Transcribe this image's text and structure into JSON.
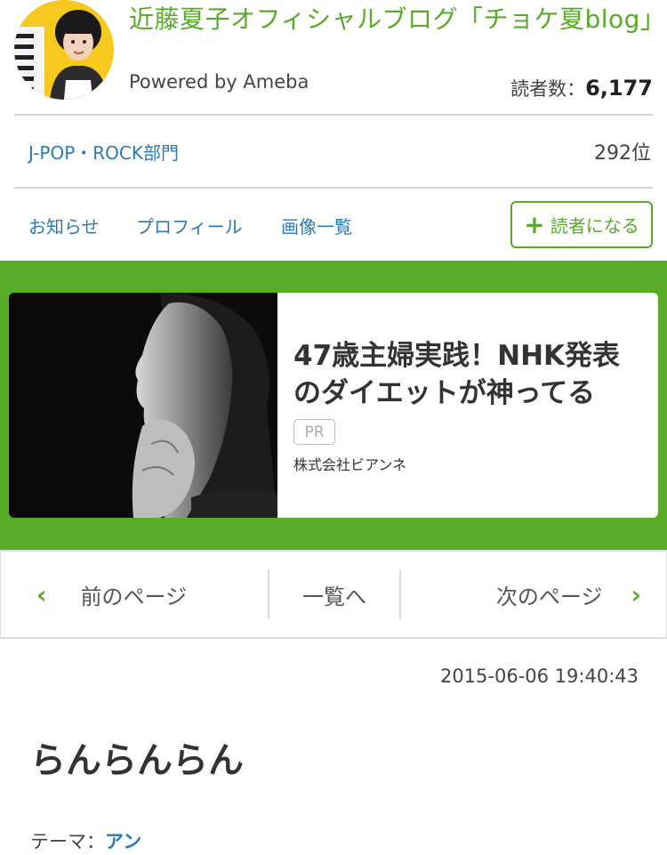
{
  "header": {
    "blog_title": "近藤夏子オフィシャルブログ「チョケ夏blog」",
    "powered_by": "Powered by Ameba",
    "readers_label": "読者数：",
    "readers_count": "6,177"
  },
  "ranking": {
    "genre": "J-POP・ROCK部門",
    "rank": "292位"
  },
  "nav": {
    "items": [
      {
        "label": "お知らせ"
      },
      {
        "label": "プロフィール"
      },
      {
        "label": "画像一覧"
      }
    ],
    "follow_label": "読者になる"
  },
  "ad": {
    "headline": "47歳主婦実践！NHK発表のダイエットが神ってる",
    "badge": "PR",
    "advertiser": "株式会社ビアンネ"
  },
  "pager": {
    "prev": "前のページ",
    "list": "一覧へ",
    "next": "次のページ"
  },
  "entry": {
    "date": "2015-06-06 19:40:43",
    "title": "らんらんらん",
    "theme_label": "テーマ：",
    "theme_value": "アン"
  },
  "colors": {
    "brand_green": "#57ab27",
    "link_blue": "#2a7ab8",
    "avatar_yellow": "#f7c81e"
  }
}
